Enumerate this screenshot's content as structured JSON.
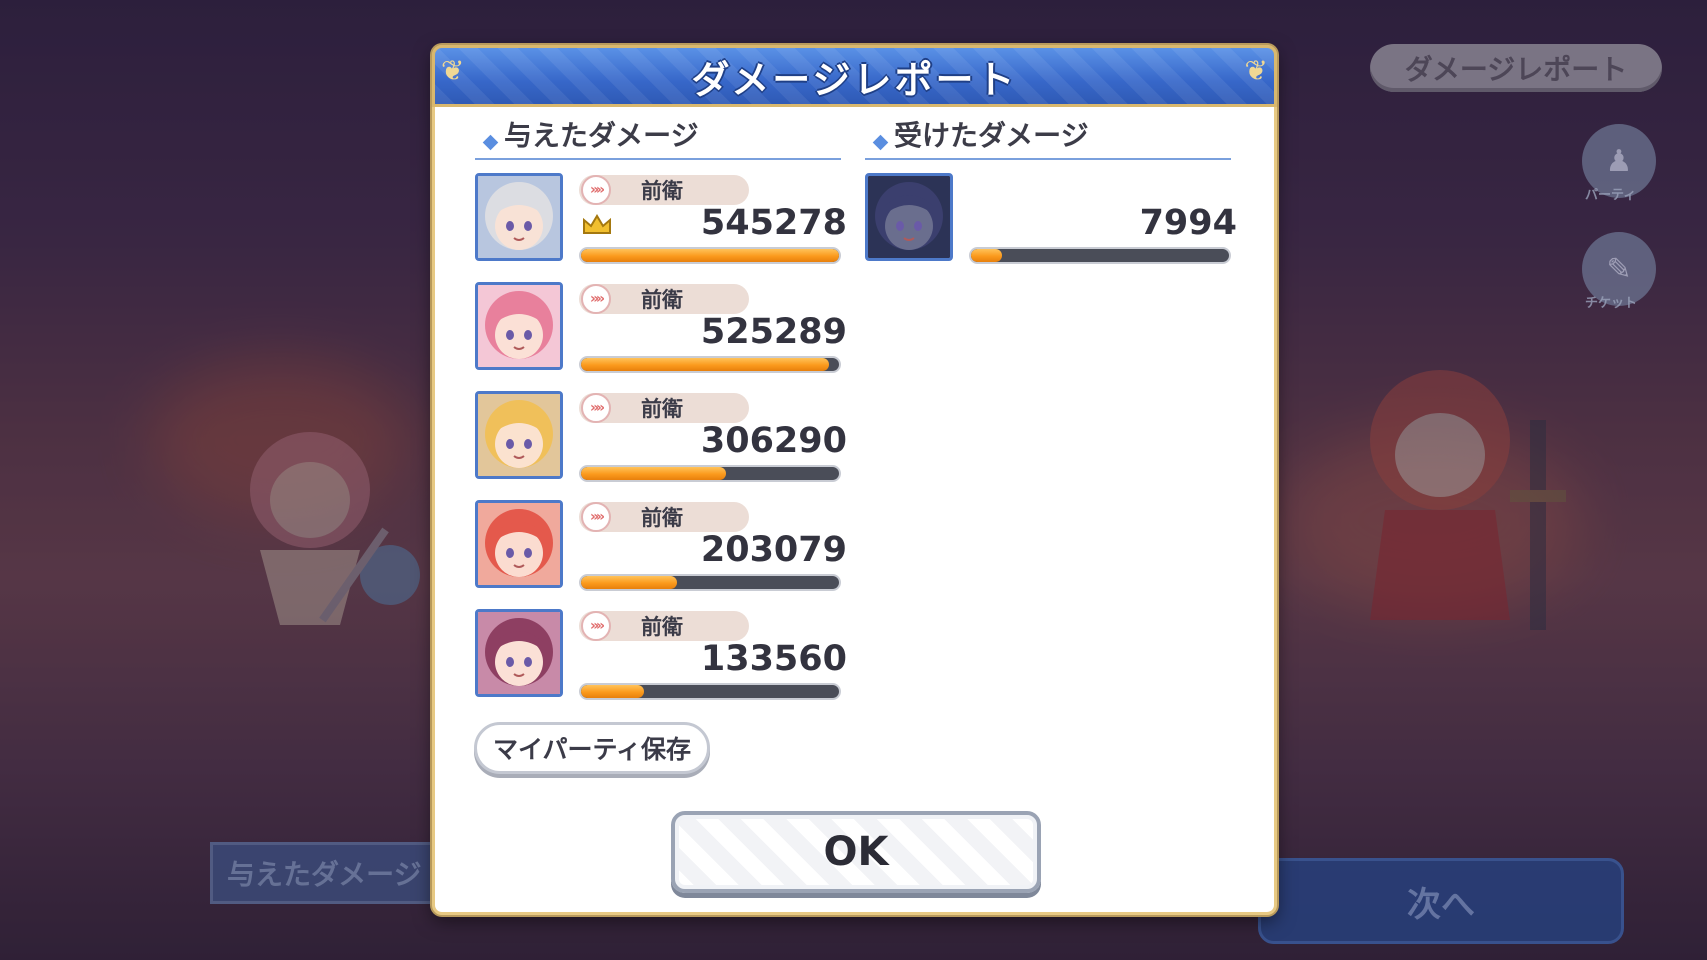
{
  "background": {
    "report_button": "ダメージレポート",
    "side_buttons": [
      {
        "icon": "party-icon",
        "caption": "パーティ"
      },
      {
        "icon": "ticket-icon",
        "caption": "チケット"
      }
    ],
    "tab_label": "与えたダメージ",
    "next_button": "次へ"
  },
  "dialog": {
    "title": "ダメージレポート",
    "dealt_section_title": "与えたダメージ",
    "received_section_title": "受けたダメージ",
    "dealt": [
      {
        "role": "前衛",
        "damage": "545278",
        "crown": true,
        "fill": 1.0,
        "portrait": {
          "hair": "#dcdde2",
          "skin": "#f8e2d6",
          "bg": "#b8c6df"
        }
      },
      {
        "role": "前衛",
        "damage": "525289",
        "crown": false,
        "fill": 0.963,
        "portrait": {
          "hair": "#e8809c",
          "skin": "#fbe0d6",
          "bg": "#f4c7d6"
        }
      },
      {
        "role": "前衛",
        "damage": "306290",
        "crown": false,
        "fill": 0.562,
        "portrait": {
          "hair": "#f0c05a",
          "skin": "#fbe2cf",
          "bg": "#e2c69a"
        }
      },
      {
        "role": "前衛",
        "damage": "203079",
        "crown": false,
        "fill": 0.372,
        "portrait": {
          "hair": "#e4594c",
          "skin": "#fbdcd0",
          "bg": "#f0a99c"
        }
      },
      {
        "role": "前衛",
        "damage": "133560",
        "crown": false,
        "fill": 0.245,
        "portrait": {
          "hair": "#8e3f62",
          "skin": "#fbe0d6",
          "bg": "#c88aa8"
        }
      }
    ],
    "received": [
      {
        "damage": "7994",
        "fill": 0.12,
        "portrait": {
          "hair": "#3b3f6e",
          "skin": "#6a6e8e",
          "bg": "#2c3356"
        }
      }
    ],
    "save_party_button": "マイパーティ保存",
    "ok_button": "OK"
  },
  "colors": {
    "header_blue": "#3767c9",
    "bar_orange": "#fb9a1d",
    "bar_track": "#4a4d58",
    "frame_gold": "#e7c983"
  }
}
